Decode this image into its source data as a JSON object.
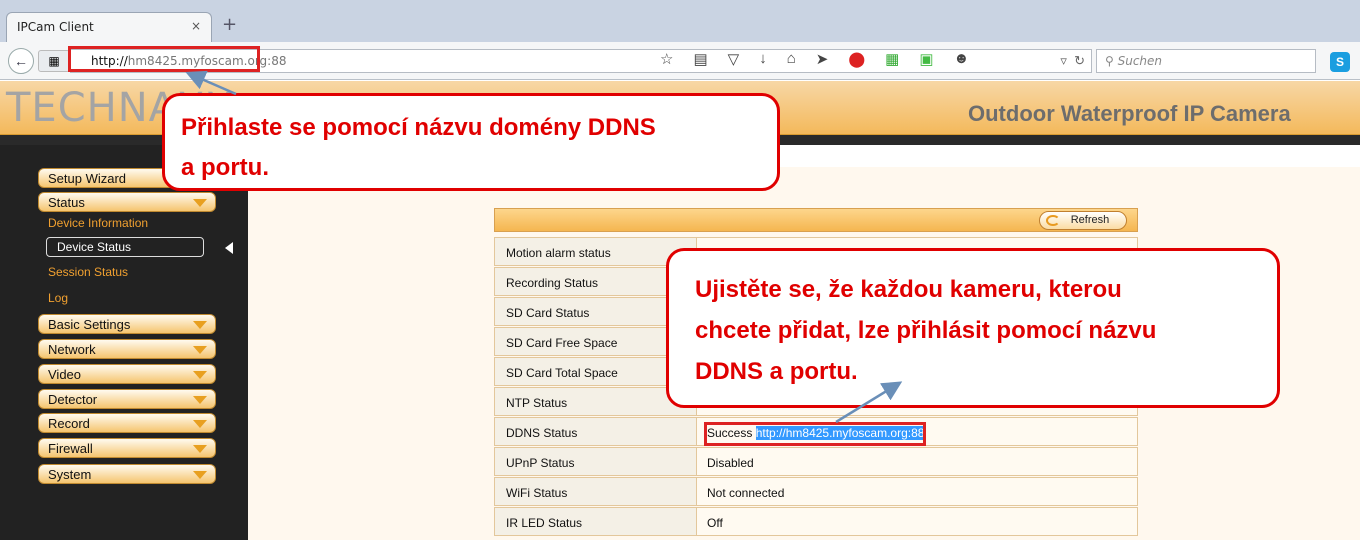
{
  "browser": {
    "tab_title": "IPCam Client",
    "tab_close": "×",
    "new_tab": "+",
    "url_prefix": "http://",
    "url_rest": "hm8425.myfoscam.org:88",
    "search_placeholder": "Suchen"
  },
  "header": {
    "logo": "TECHNAXX",
    "title": "Outdoor Waterproof IP Camera"
  },
  "sidebar": {
    "setup_wizard": "Setup Wizard",
    "status": "Status",
    "status_items": [
      "Device Information",
      "Device Status",
      "Session Status",
      "Log"
    ],
    "menus": [
      "Basic Settings",
      "Network",
      "Video",
      "Detector",
      "Record",
      "Firewall",
      "System"
    ]
  },
  "table": {
    "refresh_label": "Refresh",
    "rows": [
      {
        "label": "Motion alarm status",
        "value": ""
      },
      {
        "label": "Recording Status",
        "value": ""
      },
      {
        "label": "SD Card Status",
        "value": ""
      },
      {
        "label": "SD Card Free Space",
        "value": ""
      },
      {
        "label": "SD Card Total Space",
        "value": ""
      },
      {
        "label": "NTP Status",
        "value": ""
      },
      {
        "label": "DDNS Status",
        "value": "Success",
        "link": "http://hm8425.myfoscam.org:88"
      },
      {
        "label": "UPnP Status",
        "value": "Disabled"
      },
      {
        "label": "WiFi Status",
        "value": "Not connected"
      },
      {
        "label": "IR LED Status",
        "value": "Off"
      }
    ]
  },
  "callouts": {
    "login_line1": "Přihlaste se pomocí názvu domény DDNS",
    "login_line2": "a portu.",
    "ensure_line1": "Ujistěte se, že každou kameru, kterou",
    "ensure_line2": "chcete přidat, lze přihlásit pomocí názvu",
    "ensure_line3": "DDNS a portu."
  },
  "colors": {
    "accent_orange": "#f5b650",
    "callout_red": "#e00000",
    "sidebar_bg": "#222222"
  }
}
